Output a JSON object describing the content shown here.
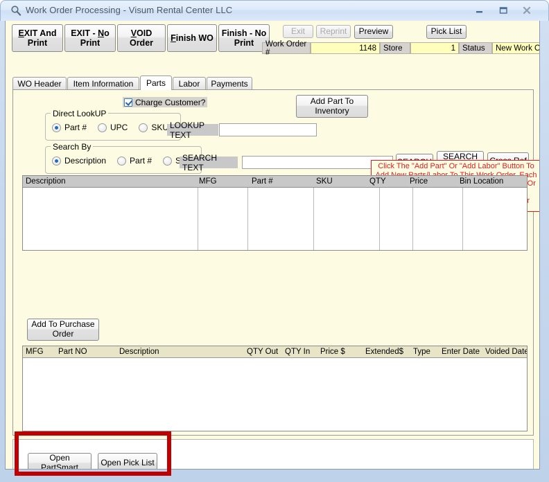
{
  "window": {
    "title": "Work Order Processing - Visum Rental Center LLC",
    "icon": "magnifier-icon",
    "minimize_label": "Minimize",
    "maximize_label": "Maximize",
    "close_label": "Close"
  },
  "toolbar": {
    "buttons": [
      {
        "label": "EXIT And\nPrint",
        "accel": "E",
        "disabled": false
      },
      {
        "label": "EXIT - No\nPrint",
        "accel": "N",
        "disabled": false
      },
      {
        "label": "VOID\nOrder",
        "accel": "V",
        "disabled": false
      },
      {
        "label": "Finish WO",
        "accel": "F",
        "disabled": false
      },
      {
        "label": "Finish - No\nPrint",
        "accel": "",
        "disabled": false
      }
    ],
    "right_buttons": [
      {
        "label": "Exit",
        "disabled": true
      },
      {
        "label": "Reprint",
        "disabled": true
      },
      {
        "label": "Preview",
        "disabled": false
      },
      {
        "label": "Pick List",
        "disabled": false
      }
    ],
    "status_bar": {
      "work_order_label": "Work Order #",
      "work_order_value": "1148",
      "store_label": "Store",
      "store_value": "1",
      "status_label": "Status",
      "status_value": "New Work Order"
    }
  },
  "tabs": [
    {
      "label": "WO Header",
      "active": false
    },
    {
      "label": "Item Information",
      "active": false
    },
    {
      "label": "Parts",
      "active": true
    },
    {
      "label": "Labor",
      "active": false
    },
    {
      "label": "Payments",
      "active": false
    }
  ],
  "parts_tab": {
    "charge_customer": {
      "label": "Charge Customer?",
      "checked": true
    },
    "direct_lookup": {
      "title": "Direct LookUP",
      "options": [
        {
          "label": "Part #",
          "selected": true
        },
        {
          "label": "UPC",
          "selected": false
        },
        {
          "label": "SKU",
          "selected": false
        }
      ],
      "field_label": "LOOKUP TEXT",
      "field_value": ""
    },
    "search_by": {
      "title": "Search By",
      "options": [
        {
          "label": "Description",
          "selected": true
        },
        {
          "label": "Part #",
          "selected": false
        },
        {
          "label": "SKU",
          "selected": false
        }
      ],
      "field_label": "SEARCH TEXT",
      "field_value": ""
    },
    "add_part_button": "Add Part To\nInventory",
    "search_button": "SEARCH",
    "search_nonstock_button": "SEARCH\nNonStock",
    "cross_ref_button": "Cross Ref",
    "instruction_text": "Click The \"Add Part\" Or \"Add Labor\" Button To Add New Parts/Labor To This Work Order. Each Line Added Can Be Charged To A Customer Or Warranty Vendor IF You Have A Customer/Vendor Assigned On The Header Page.",
    "lookup_grid": {
      "columns": [
        "Description",
        "MFG",
        "Part #",
        "SKU",
        "QTY",
        "Price",
        "Bin Location"
      ],
      "rows": []
    },
    "add_to_po_button": "Add To Purchase\nOrder",
    "lines_grid": {
      "columns": [
        "MFG",
        "Part NO",
        "Description",
        "QTY Out",
        "QTY In",
        "Price $",
        "Extended$",
        "Type",
        "Enter Date",
        "Voided Date"
      ],
      "rows": []
    },
    "bottom_buttons": [
      {
        "label": "Open PartSmart"
      },
      {
        "label": "Open Pick List"
      }
    ]
  },
  "colors": {
    "form_background": "#fdfce2",
    "highlight_red": "#c00000",
    "instruction_red": "#e01c1c",
    "field_yellow": "#ffffbb",
    "grid_header_gray": "#c8c8c8",
    "grid_header_cream": "#e8e4c8"
  }
}
